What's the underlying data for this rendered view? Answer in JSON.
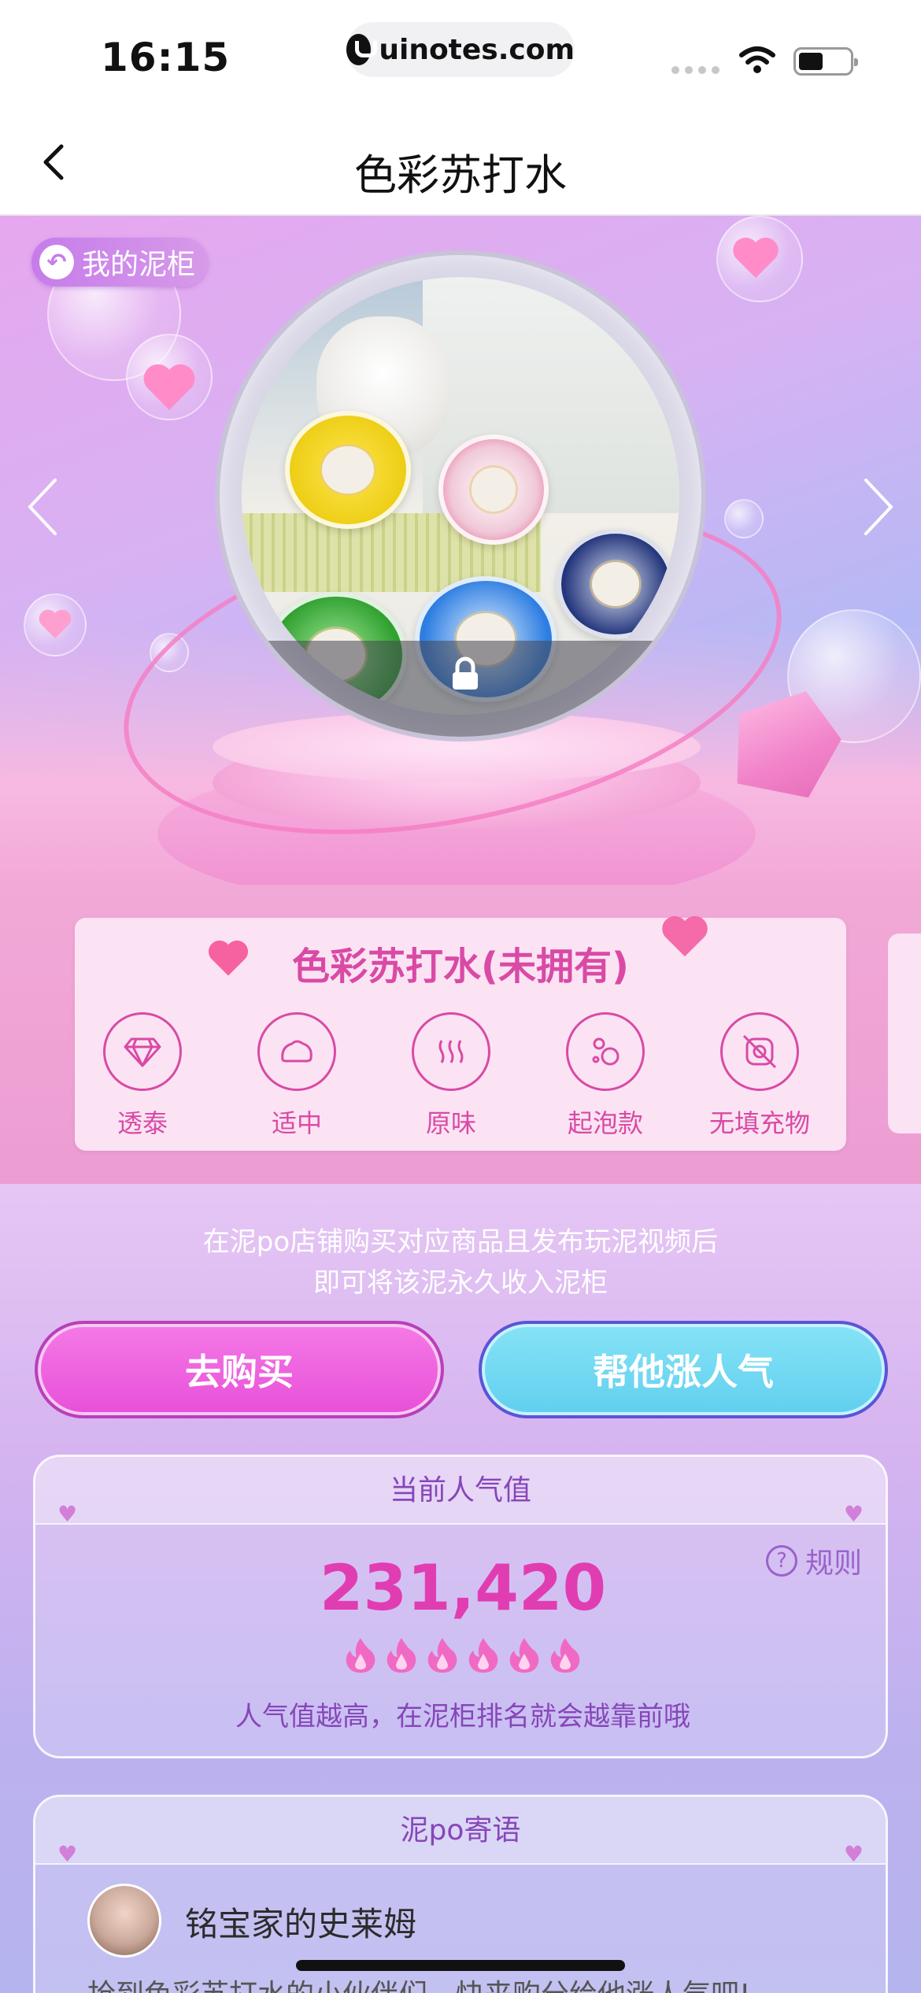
{
  "status_bar": {
    "time": "16:15",
    "url": "uinotes.com"
  },
  "nav": {
    "title": "色彩苏打水",
    "back_icon": "chevron-left-icon"
  },
  "hero": {
    "my_cabinet_label": "我的泥柜",
    "locked": true,
    "accent_color": "#f57fc4"
  },
  "product": {
    "name": "色彩苏打水(未拥有)",
    "features": [
      {
        "label": "透泰",
        "icon": "diamond-icon"
      },
      {
        "label": "适中",
        "icon": "blob-icon"
      },
      {
        "label": "原味",
        "icon": "scent-waves-icon"
      },
      {
        "label": "起泡款",
        "icon": "bubbles-icon"
      },
      {
        "label": "无填充物",
        "icon": "no-filler-icon"
      }
    ]
  },
  "purchase": {
    "hint_line1": "在泥po店铺购买对应商品且发布玩泥视频后",
    "hint_line2": "即可将该泥永久收入泥柜",
    "buy_label": "去购买",
    "boost_label": "帮他涨人气"
  },
  "popularity": {
    "header": "当前人气值",
    "rules_label": "规则",
    "value": "231,420",
    "flame_count": 6,
    "tip": "人气值越高，在泥柜排名就会越靠前哦"
  },
  "messages": {
    "header": "泥po寄语",
    "user_name": "铭宝家的史莱姆",
    "text": "抢到色彩苏打水的小伙伴们，快来购分给他涨人气吧!"
  },
  "colors": {
    "brand_pink": "#d94aa5",
    "buy_button": "#e74fd9",
    "boost_button": "#61cfef",
    "popularity_value": "#e13db2"
  }
}
